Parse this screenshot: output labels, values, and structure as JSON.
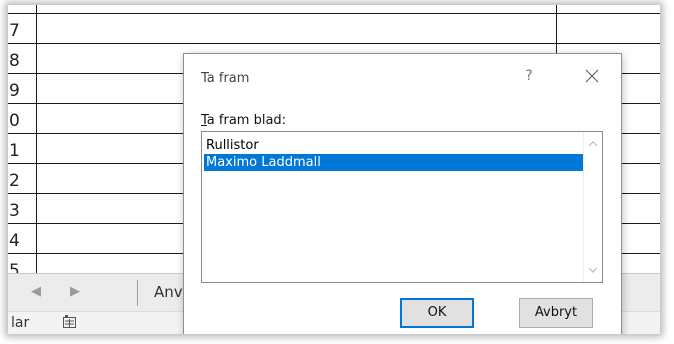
{
  "sheet": {
    "row_headers": [
      "7",
      "8",
      "9",
      "0",
      "1",
      "2",
      "3",
      "4",
      "5"
    ],
    "tab_label": "Anv"
  },
  "tabbar": {
    "prev_icon": "chevron-left-icon",
    "next_icon": "chevron-right-icon"
  },
  "statusbar": {
    "text": "lar",
    "icon": "accessibility-icon"
  },
  "dialog": {
    "title": "Ta fram",
    "help_label": "?",
    "close_icon": "close-icon",
    "list_label_mnemonic": "T",
    "list_label_rest": "a fram blad:",
    "items": [
      "Rullistor",
      "Maximo Laddmall"
    ],
    "selected_item": "Maximo Laddmall",
    "ok_label": "OK",
    "cancel_label": "Avbryt",
    "accent_color": "#0078d7"
  }
}
